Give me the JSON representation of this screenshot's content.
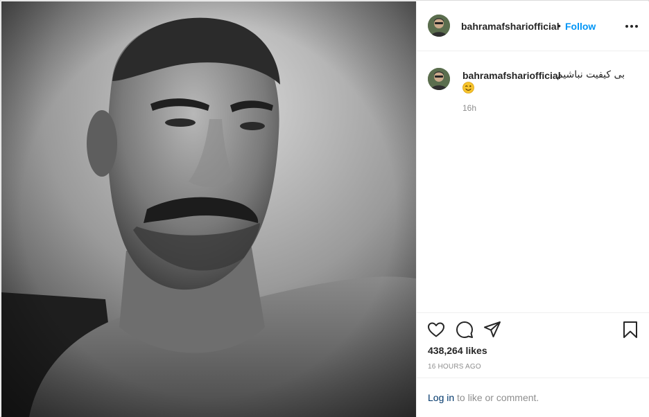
{
  "post": {
    "username": "bahramafshariofficial",
    "follow_separator": "•",
    "follow_label": "Follow",
    "caption_text": "بی کیفیت نباشیم",
    "caption_emoji": "wink-emoji",
    "comment_age": "16h",
    "likes_text": "438,264 likes",
    "timestamp": "16 HOURS AGO"
  },
  "login": {
    "link_label": "Log in",
    "suffix": " to like or comment."
  },
  "icons": {
    "like": "heart-icon",
    "comment": "comment-icon",
    "share": "share-icon",
    "save": "bookmark-icon",
    "more": "more-options-icon"
  },
  "colors": {
    "accent": "#0095f6",
    "link_dark": "#00376b",
    "text": "#262626",
    "muted": "#8e8e8e",
    "border": "#efefef"
  }
}
